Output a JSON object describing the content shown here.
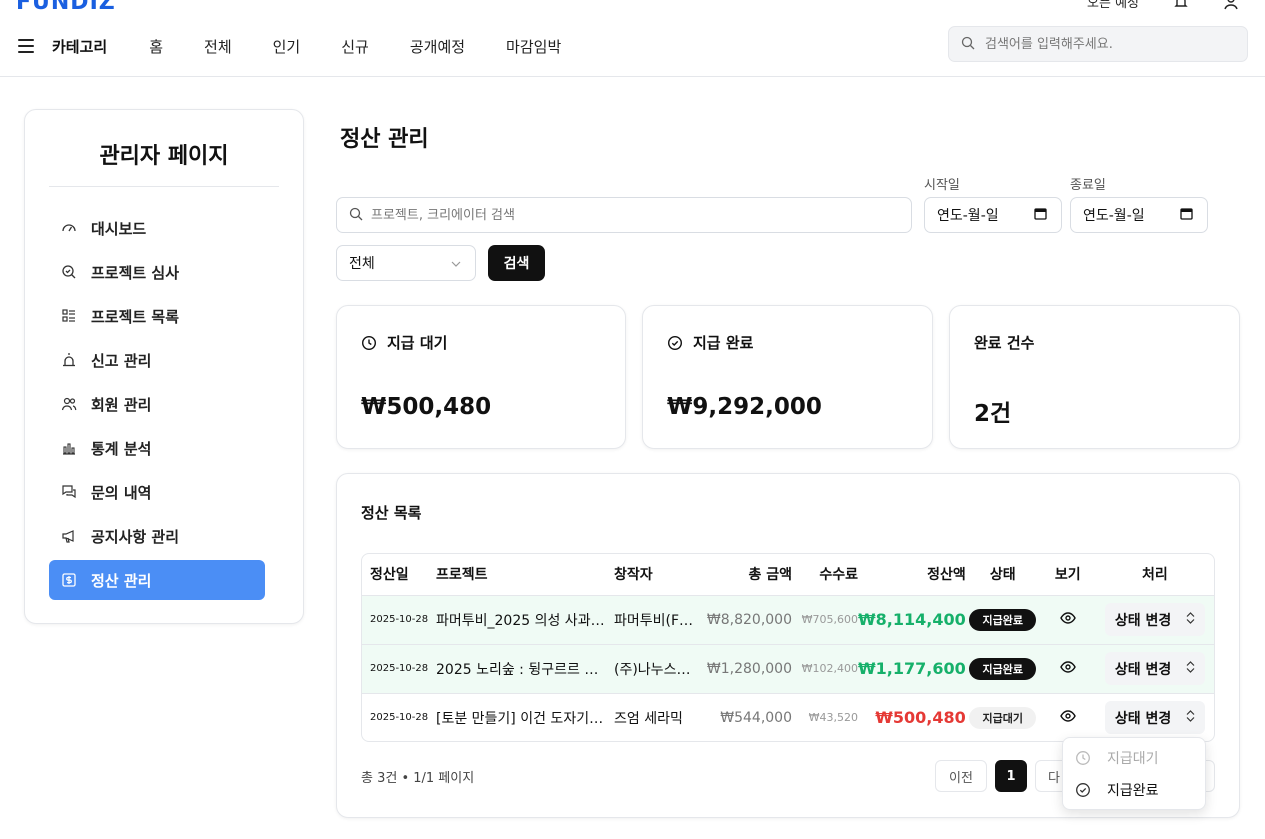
{
  "header": {
    "logo": "FUNDIZ",
    "top_links": [
      "오픈 예정"
    ],
    "category_label": "카테고리",
    "nav": [
      "홈",
      "전체",
      "인기",
      "신규",
      "공개예정",
      "마감임박"
    ],
    "search_placeholder": "검색어를 입력해주세요."
  },
  "sidebar": {
    "title": "관리자 페이지",
    "items": [
      {
        "label": "대시보드",
        "icon": "gauge-icon"
      },
      {
        "label": "프로젝트 심사",
        "icon": "search-check-icon"
      },
      {
        "label": "프로젝트 목록",
        "icon": "list-icon"
      },
      {
        "label": "신고 관리",
        "icon": "siren-icon"
      },
      {
        "label": "회원 관리",
        "icon": "users-icon"
      },
      {
        "label": "통계 분석",
        "icon": "bar-chart-icon"
      },
      {
        "label": "문의 내역",
        "icon": "messages-icon"
      },
      {
        "label": "공지사항 관리",
        "icon": "megaphone-icon"
      },
      {
        "label": "정산 관리",
        "icon": "dollar-icon",
        "active": true
      }
    ]
  },
  "main": {
    "title": "정산 관리",
    "filters": {
      "search_placeholder": "프로젝트, 크리에이터 검색",
      "start_label": "시작일",
      "end_label": "종료일",
      "date_placeholder": "연도-월-일",
      "status_select": "전체",
      "search_button": "검색"
    },
    "stats": [
      {
        "label": "지급 대기",
        "value": "₩500,480",
        "icon": "clock-icon"
      },
      {
        "label": "지급 완료",
        "value": "₩9,292,000",
        "icon": "check-circle-icon"
      },
      {
        "label": "완료 건수",
        "value": "2건"
      }
    ],
    "list": {
      "title": "정산 목록",
      "columns": [
        "정산일",
        "프로젝트",
        "창작자",
        "총 금액",
        "수수료",
        "정산액",
        "상태",
        "보기",
        "처리"
      ],
      "rows": [
        {
          "date": "2025-10-28",
          "project": "파머투비_2025 의성 사과…",
          "creator": "파머투비(F…",
          "total": "₩8,820,000",
          "fee": "₩705,600",
          "net": "₩8,114,400",
          "status": "지급완료",
          "action": "상태 변경"
        },
        {
          "date": "2025-10-28",
          "project": "2025 노리숲 : 뒹구르르 땅땅",
          "creator": "(주)나누스…",
          "total": "₩1,280,000",
          "fee": "₩102,400",
          "net": "₩1,177,600",
          "status": "지급완료",
          "action": "상태 변경"
        },
        {
          "date": "2025-10-28",
          "project": "[토분 만들기] 이건 도자기…",
          "creator": "즈엄 세라믹",
          "total": "₩544,000",
          "fee": "₩43,520",
          "net": "₩500,480",
          "status": "지급대기",
          "action": "상태 변경"
        }
      ],
      "summary": "총 3건 • 1/1 페이지",
      "pagination": {
        "prev": "이전",
        "current": "1",
        "next": "다"
      }
    },
    "status_dropdown": {
      "options": [
        {
          "label": "지급대기",
          "icon": "clock-icon",
          "disabled": true
        },
        {
          "label": "지급완료",
          "icon": "check-circle-icon",
          "disabled": false
        }
      ]
    }
  },
  "colors": {
    "accent": "#4b8ef5",
    "green": "#16b06a",
    "red": "#e53935",
    "logo": "#1a5fe0"
  }
}
